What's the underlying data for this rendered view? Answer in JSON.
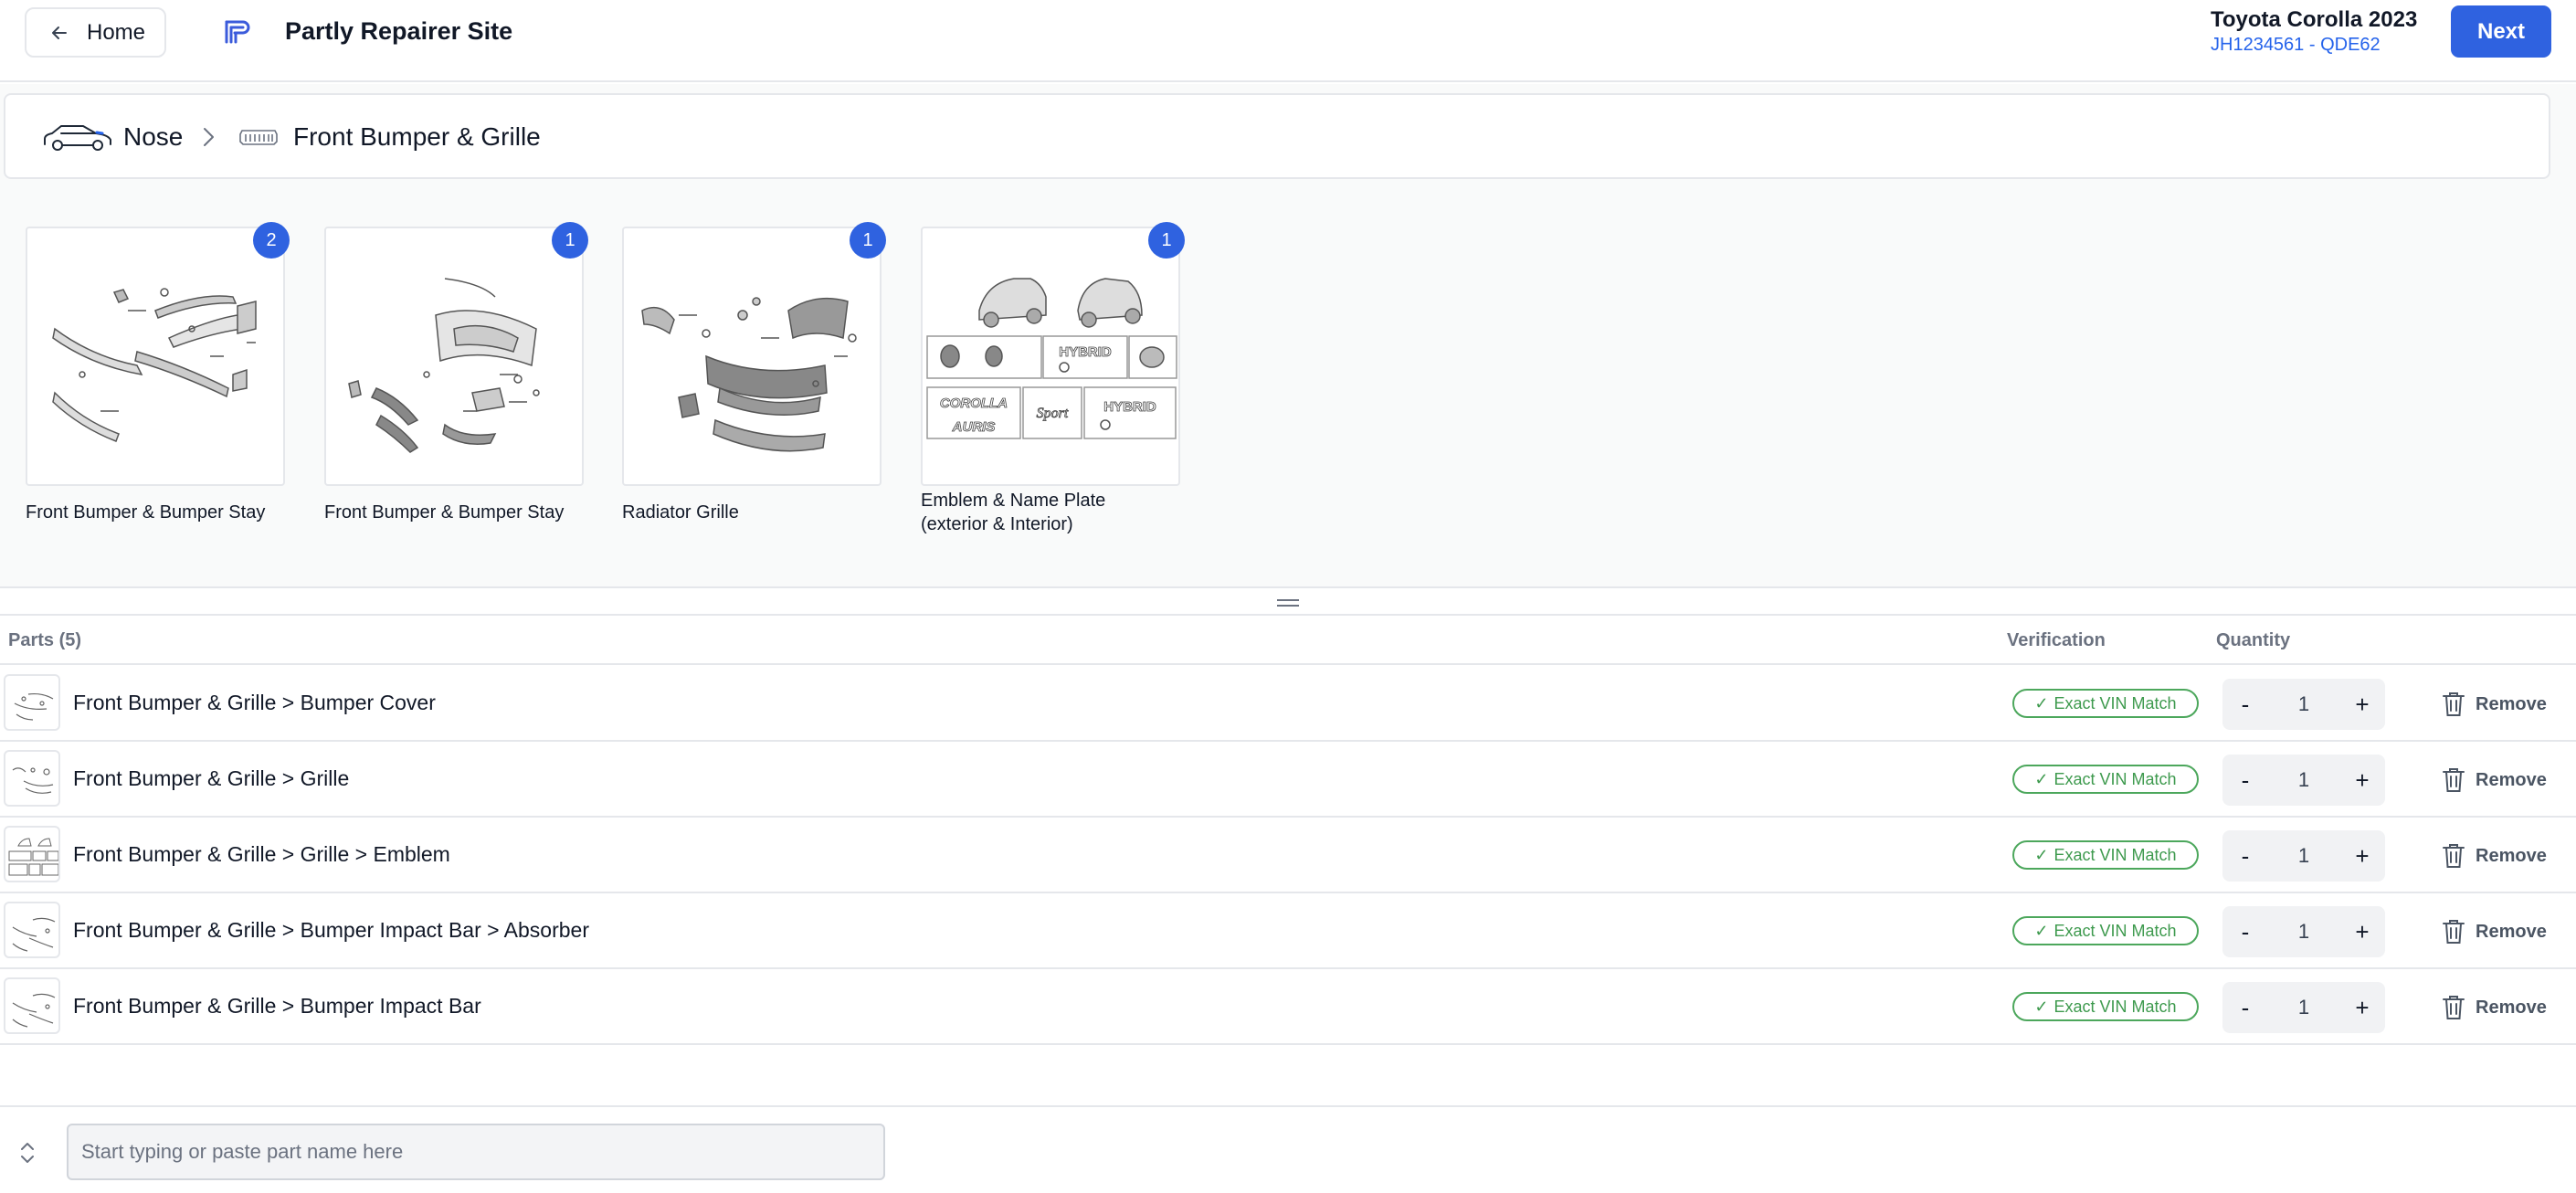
{
  "header": {
    "home_label": "Home",
    "site_title": "Partly Repairer Site",
    "vehicle_name": "Toyota Corolla 2023",
    "vehicle_vin": "JH1234561 - QDE62",
    "next_label": "Next"
  },
  "breadcrumb": {
    "items": [
      {
        "label": "Nose",
        "icon": "car-icon"
      },
      {
        "label": "Front Bumper & Grille",
        "icon": "grille-icon"
      }
    ]
  },
  "diagrams": [
    {
      "caption": "Front Bumper & Bumper Stay",
      "count": "2",
      "art": "bumper-stay"
    },
    {
      "caption": "Front Bumper & Bumper Stay",
      "count": "1",
      "art": "bumper-cover"
    },
    {
      "caption": "Radiator Grille",
      "count": "1",
      "art": "radiator-grille"
    },
    {
      "caption": "Emblem & Name Plate (exterior & Interior)",
      "count": "1",
      "art": "emblems"
    }
  ],
  "emblem_texts": [
    "HYBRID",
    "COROLLA",
    "AURIS",
    "Sport",
    "HYBRID"
  ],
  "parts": {
    "header": "Parts (5)",
    "verification_header": "Verification",
    "quantity_header": "Quantity",
    "rows": [
      {
        "name": "Front Bumper & Grille > Bumper Cover",
        "verification": "Exact VIN Match",
        "quantity": "1",
        "remove_label": "Remove"
      },
      {
        "name": "Front Bumper & Grille > Grille",
        "verification": "Exact VIN Match",
        "quantity": "1",
        "remove_label": "Remove"
      },
      {
        "name": "Front Bumper & Grille > Grille > Emblem",
        "verification": "Exact VIN Match",
        "quantity": "1",
        "remove_label": "Remove"
      },
      {
        "name": "Front Bumper & Grille > Bumper Impact Bar > Absorber",
        "verification": "Exact VIN Match",
        "quantity": "1",
        "remove_label": "Remove"
      },
      {
        "name": "Front Bumper & Grille > Bumper Impact Bar",
        "verification": "Exact VIN Match",
        "quantity": "1",
        "remove_label": "Remove"
      }
    ],
    "minus_label": "-",
    "plus_label": "+",
    "check_glyph": "✓"
  },
  "search": {
    "placeholder": "Start typing or paste part name here"
  },
  "colors": {
    "accent": "#2f62e0",
    "vin_link": "#2563eb",
    "match_green": "#4ca75c"
  }
}
